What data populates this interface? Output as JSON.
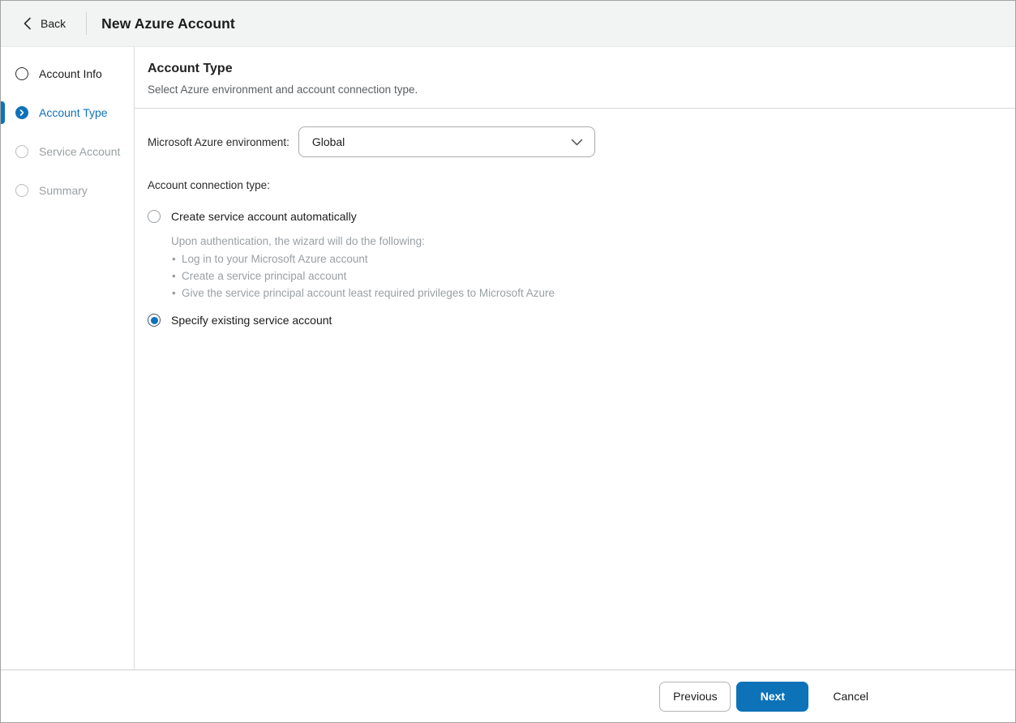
{
  "colors": {
    "accent_blue": "#0e72b8",
    "header_bg": "#f2f3f3",
    "muted_gray": "#9aa0a4",
    "divider_gray": "#d6d7d8"
  },
  "header": {
    "back_label": "Back",
    "title": "New Azure Account",
    "icons": {
      "back_chevron": "chevron-left"
    }
  },
  "sidebar": {
    "steps": [
      {
        "label": "Account Info",
        "state": "visited"
      },
      {
        "label": "Account Type",
        "state": "active"
      },
      {
        "label": "Service Account",
        "state": "upcoming"
      },
      {
        "label": "Summary",
        "state": "upcoming"
      }
    ]
  },
  "main": {
    "title": "Account Type",
    "subtitle": "Select Azure environment and account connection type.",
    "environment": {
      "label": "Microsoft Azure environment:",
      "selected_value": "Global",
      "icon": "chevron-down"
    },
    "connection_type": {
      "label": "Account connection type:",
      "options": [
        {
          "label": "Create service account automatically",
          "selected": false,
          "description": "Upon authentication, the wizard will do the following:",
          "bullets": [
            "Log in to your Microsoft Azure account",
            "Create a service principal account",
            "Give the service principal account least required privileges to Microsoft Azure"
          ]
        },
        {
          "label": "Specify existing service account",
          "selected": true
        }
      ]
    }
  },
  "footer": {
    "previous_label": "Previous",
    "next_label": "Next",
    "cancel_label": "Cancel"
  }
}
